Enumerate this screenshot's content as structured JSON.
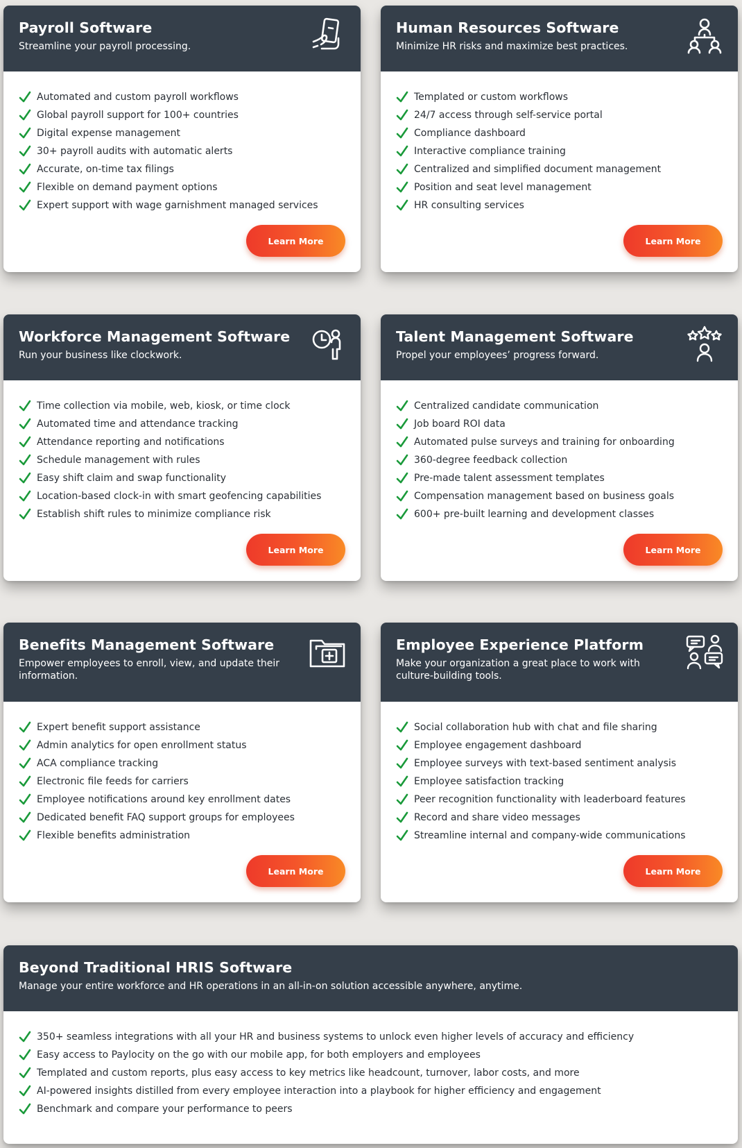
{
  "cards": [
    {
      "title": "Payroll Software",
      "subtitle": "Streamline your payroll processing.",
      "icon": "hand-phone-icon",
      "items": [
        "Automated and custom payroll workflows",
        "Global payroll support for 100+ countries",
        "Digital expense management",
        "30+ payroll audits with automatic alerts",
        "Accurate, on-time tax filings",
        "Flexible on demand payment options",
        "Expert support with wage garnishment managed services"
      ],
      "button": "Learn More"
    },
    {
      "title": "Human Resources Software",
      "subtitle": "Minimize HR risks and maximize best practices.",
      "icon": "org-chart-icon",
      "items": [
        "Templated or custom workflows",
        "24/7 access through self-service portal",
        "Compliance dashboard",
        "Interactive compliance training",
        "Centralized and simplified document management",
        "Position and seat level management",
        "HR consulting services"
      ],
      "button": "Learn More"
    },
    {
      "title": "Workforce Management Software",
      "subtitle": "Run your business like clockwork.",
      "icon": "clock-person-icon",
      "items": [
        "Time collection via mobile, web, kiosk, or time clock",
        "Automated time and attendance tracking",
        "Attendance reporting and notifications",
        "Schedule management with rules",
        "Easy shift claim and swap functionality",
        "Location-based clock-in with smart geofencing capabilities",
        "Establish shift rules to minimize compliance risk"
      ],
      "button": "Learn More"
    },
    {
      "title": "Talent Management Software",
      "subtitle": "Propel your employees’ progress forward.",
      "icon": "stars-person-icon",
      "items": [
        "Centralized candidate communication",
        "Job board ROI data",
        "Automated pulse surveys and training for onboarding",
        "360-degree feedback collection",
        "Pre-made talent assessment templates",
        "Compensation management based on business goals",
        "600+ pre-built learning and development classes"
      ],
      "button": "Learn More"
    },
    {
      "title": "Benefits Management Software",
      "subtitle": "Empower employees to enroll, view, and update their information.",
      "icon": "medical-folder-icon",
      "items": [
        "Expert benefit support assistance",
        "Admin analytics for open enrollment status",
        "ACA compliance tracking",
        "Electronic file feeds for carriers",
        "Employee notifications around key enrollment dates",
        "Dedicated benefit FAQ support groups for employees",
        "Flexible benefits administration"
      ],
      "button": "Learn More"
    },
    {
      "title": "Employee Experience Platform",
      "subtitle": "Make your organization a great place to work with culture-building tools.",
      "icon": "chat-people-icon",
      "items": [
        "Social collaboration hub with chat and file sharing",
        "Employee engagement dashboard",
        "Employee surveys with text-based sentiment analysis",
        "Employee satisfaction tracking",
        "Peer recognition functionality with leaderboard features",
        "Record and share video messages",
        "Streamline internal and company-wide communications"
      ],
      "button": "Learn More"
    },
    {
      "title": "Beyond Traditional HRIS Software",
      "subtitle": "Manage your entire workforce and HR operations in an all-in-on solution accessible anywhere, anytime.",
      "items": [
        "350+ seamless integrations with all your HR and business systems to unlock even higher levels of accuracy and efficiency",
        "Easy access to Paylocity on the go with our mobile app, for both employers and employees",
        "Templated and custom reports, plus easy access to key metrics like headcount, turnover, labor costs, and more",
        "AI-powered insights distilled from every employee interaction into a playbook for higher efficiency and engagement",
        "Benchmark and compare your performance to peers"
      ]
    }
  ],
  "colors": {
    "header_bg": "#353f4a",
    "check_green": "#1a9a3a",
    "button_gradient_start": "#ee3a2a",
    "button_gradient_end": "#f98a26"
  }
}
